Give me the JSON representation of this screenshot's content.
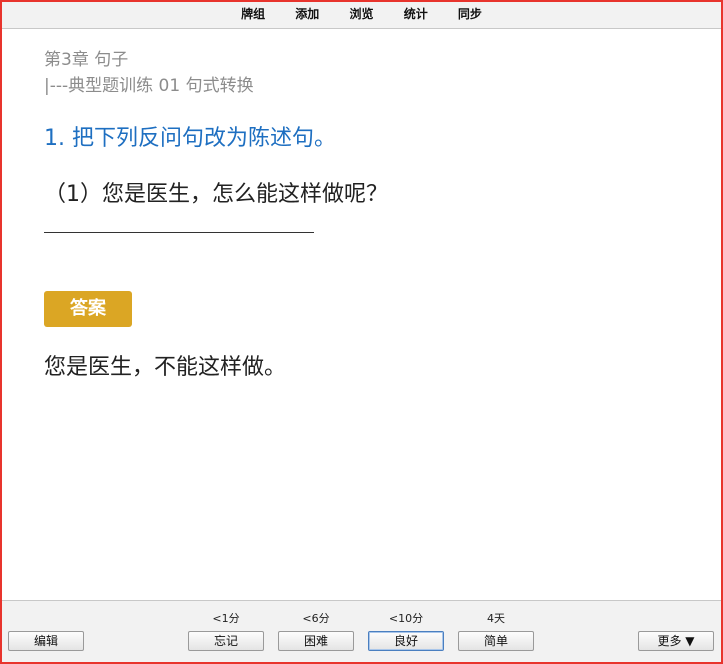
{
  "menu": {
    "items": [
      "牌组",
      "添加",
      "浏览",
      "统计",
      "同步"
    ]
  },
  "card": {
    "chapter": "第3章 句子",
    "section": "|---典型题训练 01 句式转换",
    "question_title": "1. 把下列反问句改为陈述句。",
    "question_body": "（1）您是医生，怎么能这样做呢？",
    "answer_label": "答案",
    "answer_text": "您是医生，不能这样做。"
  },
  "bottom": {
    "edit_label": "编辑",
    "more_label": "更多 ▼",
    "ratings": [
      {
        "interval": "<1分",
        "label": "忘记"
      },
      {
        "interval": "<6分",
        "label": "困难"
      },
      {
        "interval": "<10分",
        "label": "良好"
      },
      {
        "interval": "4天",
        "label": "简单"
      }
    ]
  },
  "colors": {
    "window_border": "#e8342d",
    "question_title": "#1e6fc1",
    "answer_badge": "#dba624",
    "muted_text": "#8c8c8c"
  }
}
